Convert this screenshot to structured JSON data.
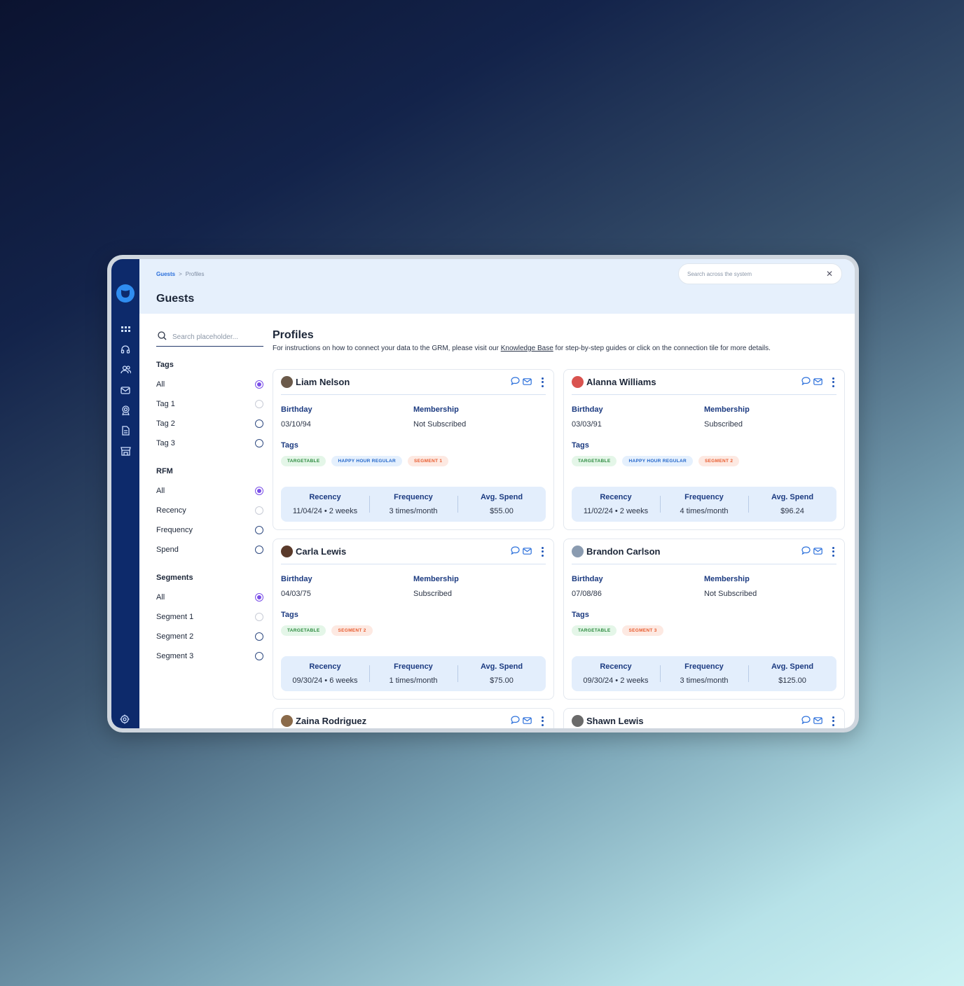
{
  "colors": {
    "rail": "#0d2a6b",
    "accent": "#2a6fdb",
    "selected_radio": "#7a4ee8"
  },
  "rail": {
    "icons": [
      "grid-icon",
      "headset-icon",
      "users-icon",
      "mail-icon",
      "award-icon",
      "document-icon",
      "store-icon"
    ],
    "bottom_icon": "gear-icon"
  },
  "breadcrumb": {
    "root": "Guests",
    "separator": ">",
    "current": "Profiles"
  },
  "header": {
    "title": "Guests",
    "search_placeholder": "Search across the system"
  },
  "filters": {
    "search_placeholder": "Search placeholder...",
    "groups": [
      {
        "title": "Tags",
        "items": [
          {
            "label": "All",
            "state": "selected"
          },
          {
            "label": "Tag 1",
            "state": "faint"
          },
          {
            "label": "Tag 2",
            "state": "normal"
          },
          {
            "label": "Tag 3",
            "state": "normal"
          }
        ]
      },
      {
        "title": "RFM",
        "items": [
          {
            "label": "All",
            "state": "selected"
          },
          {
            "label": "Recency",
            "state": "faint"
          },
          {
            "label": "Frequency",
            "state": "normal"
          },
          {
            "label": "Spend",
            "state": "normal"
          }
        ]
      },
      {
        "title": "Segments",
        "items": [
          {
            "label": "All",
            "state": "selected"
          },
          {
            "label": "Segment 1",
            "state": "faint"
          },
          {
            "label": "Segment 2",
            "state": "normal"
          },
          {
            "label": "Segment 3",
            "state": "normal"
          }
        ]
      }
    ]
  },
  "profiles": {
    "title": "Profiles",
    "subtitle_before": "For instructions on how to connect your data to the GRM, please visit our ",
    "subtitle_link": "Knowledge Base",
    "subtitle_after": " for step-by-step guides or click on the connection tile for more details.",
    "labels": {
      "birthday": "Birthday",
      "membership": "Membership",
      "tags": "Tags",
      "recency": "Recency",
      "frequency": "Frequency",
      "avg_spend": "Avg. Spend"
    },
    "cards": [
      {
        "name": "Liam Nelson",
        "avatar_color": "#6b5a4a",
        "birthday": "03/10/94",
        "membership": "Not Subscribed",
        "tags": [
          {
            "text": "TARGETABLE",
            "color": "green"
          },
          {
            "text": "HAPPY HOUR REGULAR",
            "color": "blue"
          },
          {
            "text": "SEGMENT 1",
            "color": "orange"
          }
        ],
        "recency": "11/04/24  •  2 weeks",
        "frequency": "3 times/month",
        "avg_spend": "$55.00"
      },
      {
        "name": "Alanna Williams",
        "avatar_color": "#d9534f",
        "birthday": "03/03/91",
        "membership": "Subscribed",
        "tags": [
          {
            "text": "TARGETABLE",
            "color": "green"
          },
          {
            "text": "HAPPY HOUR REGULAR",
            "color": "blue"
          },
          {
            "text": "SEGMENT 2",
            "color": "orange"
          }
        ],
        "recency": "11/02/24  •  2 weeks",
        "frequency": "4 times/month",
        "avg_spend": "$96.24"
      },
      {
        "name": "Carla Lewis",
        "avatar_color": "#5a3a2a",
        "birthday": "04/03/75",
        "membership": "Subscribed",
        "tags": [
          {
            "text": "TARGETABLE",
            "color": "green"
          },
          {
            "text": "SEGMENT 2",
            "color": "orange"
          }
        ],
        "recency": "09/30/24  •  6 weeks",
        "frequency": "1 times/month",
        "avg_spend": "$75.00"
      },
      {
        "name": "Brandon Carlson",
        "avatar_color": "#8a9bb0",
        "birthday": "07/08/86",
        "membership": "Not Subscribed",
        "tags": [
          {
            "text": "TARGETABLE",
            "color": "green"
          },
          {
            "text": "SEGMENT 3",
            "color": "orange"
          }
        ],
        "recency": "09/30/24  •  2 weeks",
        "frequency": "3 times/month",
        "avg_spend": "$125.00"
      },
      {
        "name": "Zaina Rodriguez",
        "avatar_color": "#8a6a4a"
      },
      {
        "name": "Shawn Lewis",
        "avatar_color": "#6a6a6a"
      }
    ]
  }
}
